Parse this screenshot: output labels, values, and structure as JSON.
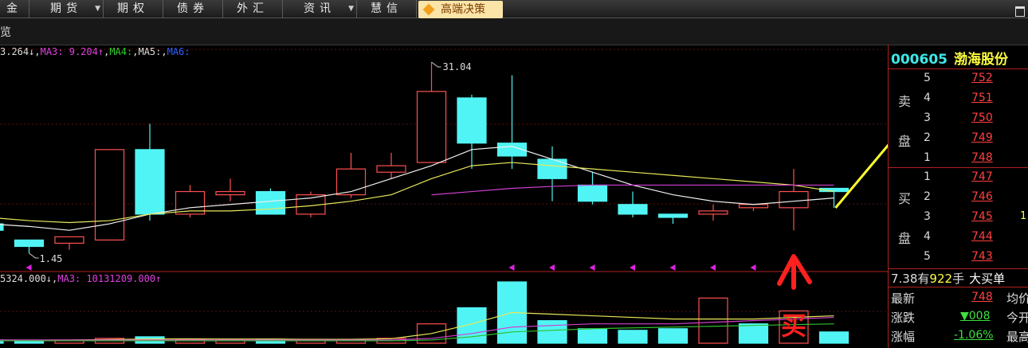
{
  "menubar": {
    "items": [
      {
        "label": "金",
        "has_dropdown": false
      },
      {
        "label": "期货",
        "has_dropdown": true
      },
      {
        "label": "期权",
        "has_dropdown": false
      },
      {
        "label": "债券",
        "has_dropdown": false
      },
      {
        "label": "外汇",
        "has_dropdown": false
      },
      {
        "label": "资讯",
        "has_dropdown": true
      },
      {
        "label": "慧信",
        "has_dropdown": false
      }
    ],
    "premium_label": "高端决策",
    "dropdown_glyph": "▼"
  },
  "subbar": {
    "label": "览"
  },
  "price_legend": {
    "ma2_value": "3.264↓",
    "ma3_label": "MA3:",
    "ma3_value": "9.204↑",
    "ma4_label": "MA4:",
    "ma5_label": "MA5:",
    "ma6_label": "MA6:"
  },
  "volume_legend": {
    "ma2_value": "5324.000↓",
    "ma3_label": "MA3:",
    "ma3_value": "10131209.000↑"
  },
  "annotations": {
    "high_label": "31.04",
    "low_label": "1.45",
    "buy_mark": "买"
  },
  "colors": {
    "up": "#ff5050",
    "down": "#50f4f4",
    "ma_white": "#f0f0f0",
    "ma_yellow": "#e8e85a",
    "ma_magenta": "#d040d0",
    "ma_green": "#30c030",
    "grid_red": "#b02020",
    "arrow_yellow": "#ffff30",
    "hand_red": "#ff2020"
  },
  "chart_data": {
    "type": "candlestick",
    "candles": [
      {
        "o": 6,
        "c": 5,
        "h": 6,
        "l": 5
      },
      {
        "o": 3.5,
        "c": 2.5,
        "h": 3.5,
        "l": 1.45
      },
      {
        "o": 3,
        "c": 4,
        "h": 4,
        "l": 2
      },
      {
        "o": 3.5,
        "c": 17.5,
        "h": 17.5,
        "l": 3.5
      },
      {
        "o": 17.5,
        "c": 7.5,
        "h": 21.5,
        "l": 6.5
      },
      {
        "o": 7.5,
        "c": 11,
        "h": 12,
        "l": 7
      },
      {
        "o": 10.5,
        "c": 11,
        "h": 13,
        "l": 9.5
      },
      {
        "o": 11,
        "c": 7.5,
        "h": 11.5,
        "l": 7.5
      },
      {
        "o": 7.5,
        "c": 10.5,
        "h": 11,
        "l": 7
      },
      {
        "o": 10.5,
        "c": 14.5,
        "h": 17,
        "l": 10
      },
      {
        "o": 14,
        "c": 15,
        "h": 17,
        "l": 13
      },
      {
        "o": 15.5,
        "c": 26.5,
        "h": 31.04,
        "l": 15.5
      },
      {
        "o": 25.5,
        "c": 18.5,
        "h": 26,
        "l": 14.5
      },
      {
        "o": 18.5,
        "c": 16.5,
        "h": 29,
        "l": 14.5
      },
      {
        "o": 16,
        "c": 13,
        "h": 18,
        "l": 9.5
      },
      {
        "o": 12,
        "c": 9.5,
        "h": 14,
        "l": 9
      },
      {
        "o": 9,
        "c": 7.5,
        "h": 11,
        "l": 7
      },
      {
        "o": 7.5,
        "c": 7,
        "h": 7.5,
        "l": 6
      },
      {
        "o": 7.5,
        "c": 8,
        "h": 9,
        "l": 6.5
      },
      {
        "o": 8.5,
        "c": 9,
        "h": 9,
        "l": 8
      },
      {
        "o": 8.5,
        "c": 11,
        "h": 14.5,
        "l": 5
      },
      {
        "o": 11.5,
        "c": 11,
        "h": 11.5,
        "l": 8.5
      }
    ],
    "ma_white": [
      6,
      5.6,
      5,
      6,
      7.5,
      8.5,
      9,
      9.5,
      10,
      11,
      13,
      15,
      17.5,
      18,
      16,
      14,
      12,
      10.5,
      9.5,
      9,
      9.5,
      10
    ],
    "ma_yellow": [
      7,
      6.5,
      6.2,
      6.5,
      7.5,
      8,
      8,
      8.3,
      8.8,
      9.5,
      10.5,
      13,
      15,
      15.5,
      15,
      14.5,
      14,
      13.5,
      13,
      12.5,
      12,
      11
    ],
    "ma_magenta": [
      null,
      null,
      null,
      null,
      null,
      null,
      null,
      null,
      null,
      null,
      null,
      10.5,
      11,
      11.5,
      11.8,
      12,
      12,
      12,
      12,
      12,
      12,
      12
    ],
    "signal_marks": [
      1,
      13,
      14,
      15,
      16,
      17,
      18,
      19
    ],
    "volume": [
      {
        "v": 2,
        "up": false
      },
      {
        "v": 1.5,
        "up": false
      },
      {
        "v": 2,
        "up": true
      },
      {
        "v": 3,
        "up": true
      },
      {
        "v": 4,
        "up": false
      },
      {
        "v": 2.5,
        "up": true
      },
      {
        "v": 2,
        "up": true
      },
      {
        "v": 2.5,
        "up": false
      },
      {
        "v": 1.5,
        "up": true
      },
      {
        "v": 2,
        "up": true
      },
      {
        "v": 3,
        "up": true
      },
      {
        "v": 12,
        "up": true
      },
      {
        "v": 22,
        "up": false
      },
      {
        "v": 38,
        "up": false
      },
      {
        "v": 14,
        "up": false
      },
      {
        "v": 9,
        "up": false
      },
      {
        "v": 8,
        "up": false
      },
      {
        "v": 9,
        "up": false
      },
      {
        "v": 28,
        "up": true
      },
      {
        "v": 12,
        "up": false
      },
      {
        "v": 20,
        "up": true
      },
      {
        "v": 7,
        "up": false
      }
    ],
    "vol_ma_yellow": [
      2,
      2,
      2,
      2.3,
      2.6,
      2.7,
      2.6,
      2.6,
      2.4,
      2.4,
      2.8,
      6,
      12,
      19,
      18,
      17,
      16,
      15,
      15,
      15,
      16,
      17
    ],
    "vol_ma_magenta": [
      2,
      2,
      2,
      2,
      2,
      2,
      2,
      2,
      2,
      2,
      2,
      3,
      6,
      10,
      11,
      12,
      12,
      12,
      13,
      14,
      15,
      16
    ],
    "vol_ma_green": [
      1.5,
      1.5,
      1.5,
      1.5,
      1.5,
      1.5,
      1.5,
      1.5,
      1.5,
      1.5,
      1.5,
      2,
      4,
      7,
      8,
      9,
      9.5,
      10,
      10.5,
      11,
      11.5,
      12
    ]
  },
  "quote_panel": {
    "code": "000605",
    "name": "渤海股份",
    "sell_label_1": "卖",
    "sell_label_2": "盘",
    "buy_label_1": "买",
    "buy_label_2": "盘",
    "sell_levels": [
      {
        "num": "5",
        "price": "752"
      },
      {
        "num": "4",
        "price": "751"
      },
      {
        "num": "3",
        "price": "750"
      },
      {
        "num": "2",
        "price": "749"
      },
      {
        "num": "1",
        "price": "748"
      }
    ],
    "buy_levels": [
      {
        "num": "1",
        "price": "747"
      },
      {
        "num": "2",
        "price": "746"
      },
      {
        "num": "3",
        "price": "745",
        "vol": "1"
      },
      {
        "num": "4",
        "price": "744"
      },
      {
        "num": "5",
        "price": "743"
      }
    ],
    "big_order": {
      "time": "7.38",
      "has": "有",
      "count": "922",
      "unit": "手",
      "text": "大买单"
    },
    "latest_label": "最新",
    "latest_value": "748",
    "avg_label": "均价",
    "change_label": "涨跌",
    "change_value": "▼008",
    "open_label": "今开",
    "pct_label": "涨幅",
    "pct_value": "-1.06%",
    "high_label": "最高"
  }
}
